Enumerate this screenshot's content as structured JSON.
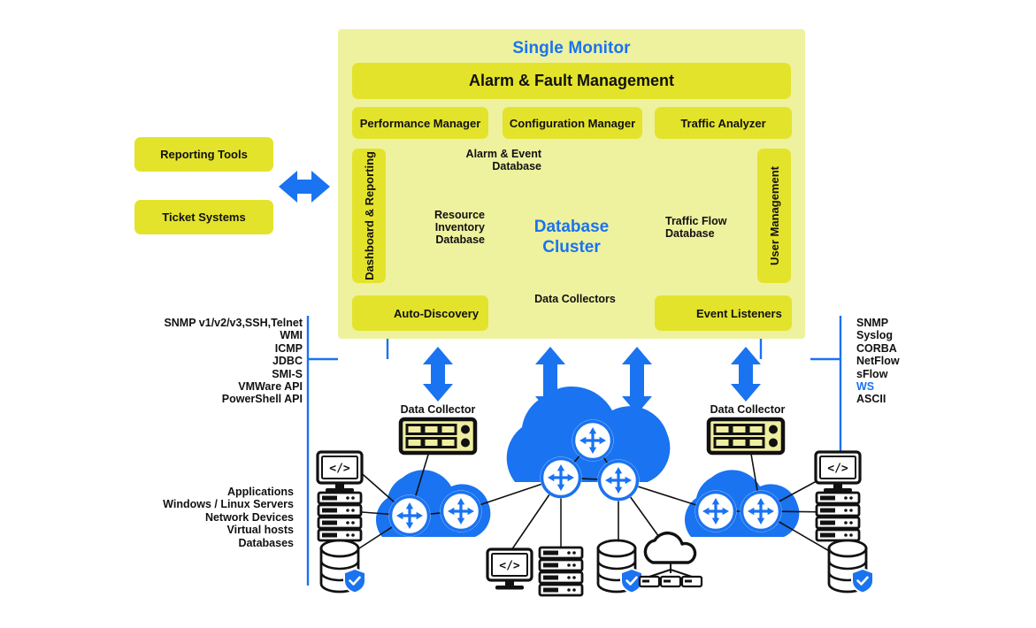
{
  "diagram": {
    "title": "Single Monitor",
    "panel": {
      "alarm_fault": "Alarm & Fault Management",
      "performance_manager": "Performance Manager",
      "configuration_manager": "Configuration Manager",
      "traffic_analyzer": "Traffic Analyzer",
      "dashboard_reporting": "Dashboard & Reporting",
      "user_management": "User Management",
      "auto_discovery": "Auto-Discovery",
      "event_listeners": "Event Listeners",
      "data_collectors": "Data Collectors"
    },
    "cluster": {
      "title_line1": "Database",
      "title_line2": "Cluster",
      "alarm_event_db": "Alarm & Event\nDatabase",
      "resource_inventory_db": "Resource\nInventory\nDatabase",
      "traffic_flow_db": "Traffic Flow\nDatabase"
    },
    "left_boxes": {
      "reporting_tools": "Reporting Tools",
      "ticket_systems": "Ticket Systems"
    },
    "left_protocols": [
      {
        "label": "SNMP v1/v2/v3,SSH,Telnet",
        "color": "#111111"
      },
      {
        "label": "WMI",
        "color": "#111111"
      },
      {
        "label": "ICMP",
        "color": "#111111"
      },
      {
        "label": "JDBC",
        "color": "#111111"
      },
      {
        "label": "SMI-S",
        "color": "#111111"
      },
      {
        "label": "VMWare API",
        "color": "#111111"
      },
      {
        "label": "PowerShell API",
        "color": "#111111"
      }
    ],
    "right_protocols": [
      {
        "label": "SNMP",
        "color": "#111111"
      },
      {
        "label": "Syslog",
        "color": "#111111"
      },
      {
        "label": "CORBA",
        "color": "#111111"
      },
      {
        "label": "NetFlow",
        "color": "#111111"
      },
      {
        "label": "sFlow",
        "color": "#111111"
      },
      {
        "label": "WS",
        "color": "#1a73f0"
      },
      {
        "label": "ASCII",
        "color": "#111111"
      }
    ],
    "monitored_entities": [
      "Applications",
      "Windows / Linux Servers",
      "Network Devices",
      "Virtual hosts",
      "Databases"
    ],
    "data_collector_label": "Data Collector",
    "colors": {
      "panel_bg": "#eef29e",
      "box_bg": "#e3e32c",
      "accent_blue": "#1a73f0",
      "cloud_blue": "#1a73f0",
      "text": "#111111"
    }
  }
}
